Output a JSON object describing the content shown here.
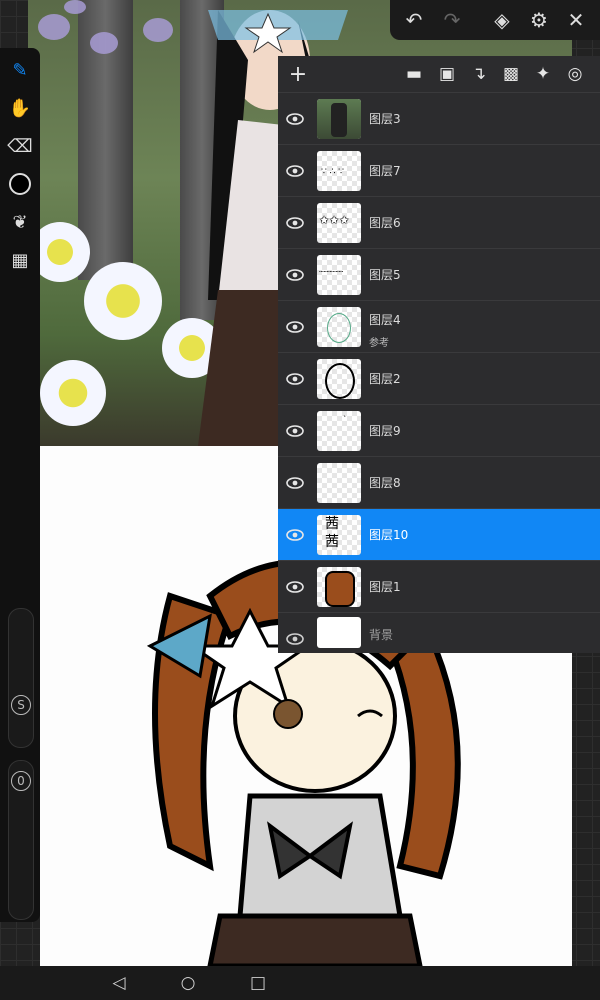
{
  "top_toolbar": {
    "undo_icon": "undo-icon",
    "redo_icon": "redo-icon",
    "layers_icon": "layers-icon",
    "settings_icon": "gear-icon",
    "close_icon": "close-icon"
  },
  "left_toolbar": {
    "tools": [
      "pen-icon",
      "smudge-icon",
      "eraser-icon",
      "color-swatch",
      "leaf-icon",
      "grid-icon"
    ],
    "color": "#000000",
    "size_slider_label": "S",
    "opacity_slider_label": "0"
  },
  "layers_panel": {
    "header_icons": [
      "add-icon",
      "folder-icon",
      "lock-icon",
      "merge-down-icon",
      "checker-icon",
      "pin-icon",
      "spiral-icon"
    ],
    "layers": [
      {
        "name": "图层3",
        "sub": "",
        "selected": false
      },
      {
        "name": "图层7",
        "sub": "",
        "selected": false
      },
      {
        "name": "图层6",
        "sub": "",
        "selected": false
      },
      {
        "name": "图层5",
        "sub": "",
        "selected": false
      },
      {
        "name": "图层4",
        "sub": "参考",
        "selected": false
      },
      {
        "name": "图层2",
        "sub": "",
        "selected": false
      },
      {
        "name": "图层9",
        "sub": "",
        "selected": false
      },
      {
        "name": "图层8",
        "sub": "",
        "selected": false
      },
      {
        "name": "图层10",
        "sub": "",
        "selected": true
      },
      {
        "name": "图层1",
        "sub": "",
        "selected": false
      }
    ],
    "background_layer": "背景",
    "thumb_text_layer10": "茜\n茜"
  },
  "colors": {
    "accent": "#1187f5",
    "panel_bg": "#2c2c2e",
    "toolbar_bg": "#111111"
  }
}
